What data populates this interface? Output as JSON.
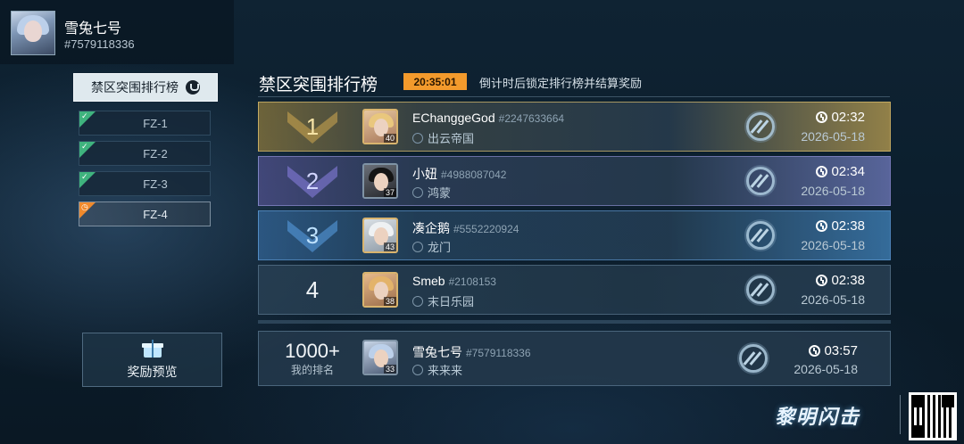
{
  "player": {
    "name": "雪兔七号",
    "id": "#7579118336"
  },
  "sidebar": {
    "main_tab": "禁区突围排行榜",
    "sub_tabs": [
      {
        "label": "FZ-1",
        "state": "completed"
      },
      {
        "label": "FZ-2",
        "state": "completed"
      },
      {
        "label": "FZ-3",
        "state": "completed"
      },
      {
        "label": "FZ-4",
        "state": "active"
      }
    ],
    "reward_preview": "奖励预览"
  },
  "panel": {
    "title": "禁区突围排行榜",
    "timer": "20:35:01",
    "timer_note": "倒计时后锁定排行榜并结算奖励"
  },
  "rankings": [
    {
      "rank": "1",
      "name": "EChanggeGod",
      "id": "#2247633664",
      "guild": "出云帝国",
      "level": "40",
      "time": "02:32",
      "date": "2026-05-18"
    },
    {
      "rank": "2",
      "name": "小妞",
      "id": "#4988087042",
      "guild": "鸿蒙",
      "level": "37",
      "time": "02:34",
      "date": "2026-05-18"
    },
    {
      "rank": "3",
      "name": "凑企鹅",
      "id": "#5552220924",
      "guild": "龙门",
      "level": "43",
      "time": "02:38",
      "date": "2026-05-18"
    },
    {
      "rank": "4",
      "name": "Smeb",
      "id": "#2108153",
      "guild": "末日乐园",
      "level": "38",
      "time": "02:38",
      "date": "2026-05-18"
    }
  ],
  "my_rank": {
    "rank": "1000+",
    "label": "我的排名",
    "name": "雪兔七号",
    "id": "#7579118336",
    "guild": "来来来",
    "level": "33",
    "time": "03:57",
    "date": "2026-05-18"
  },
  "brand": {
    "logo_text": "黎明闪击"
  },
  "colors": {
    "timer_bg": "#f39a2c",
    "completed_tab": "#3fb37e",
    "active_tab": "#f08a2c",
    "rank1_gold": "#d9b46e"
  }
}
